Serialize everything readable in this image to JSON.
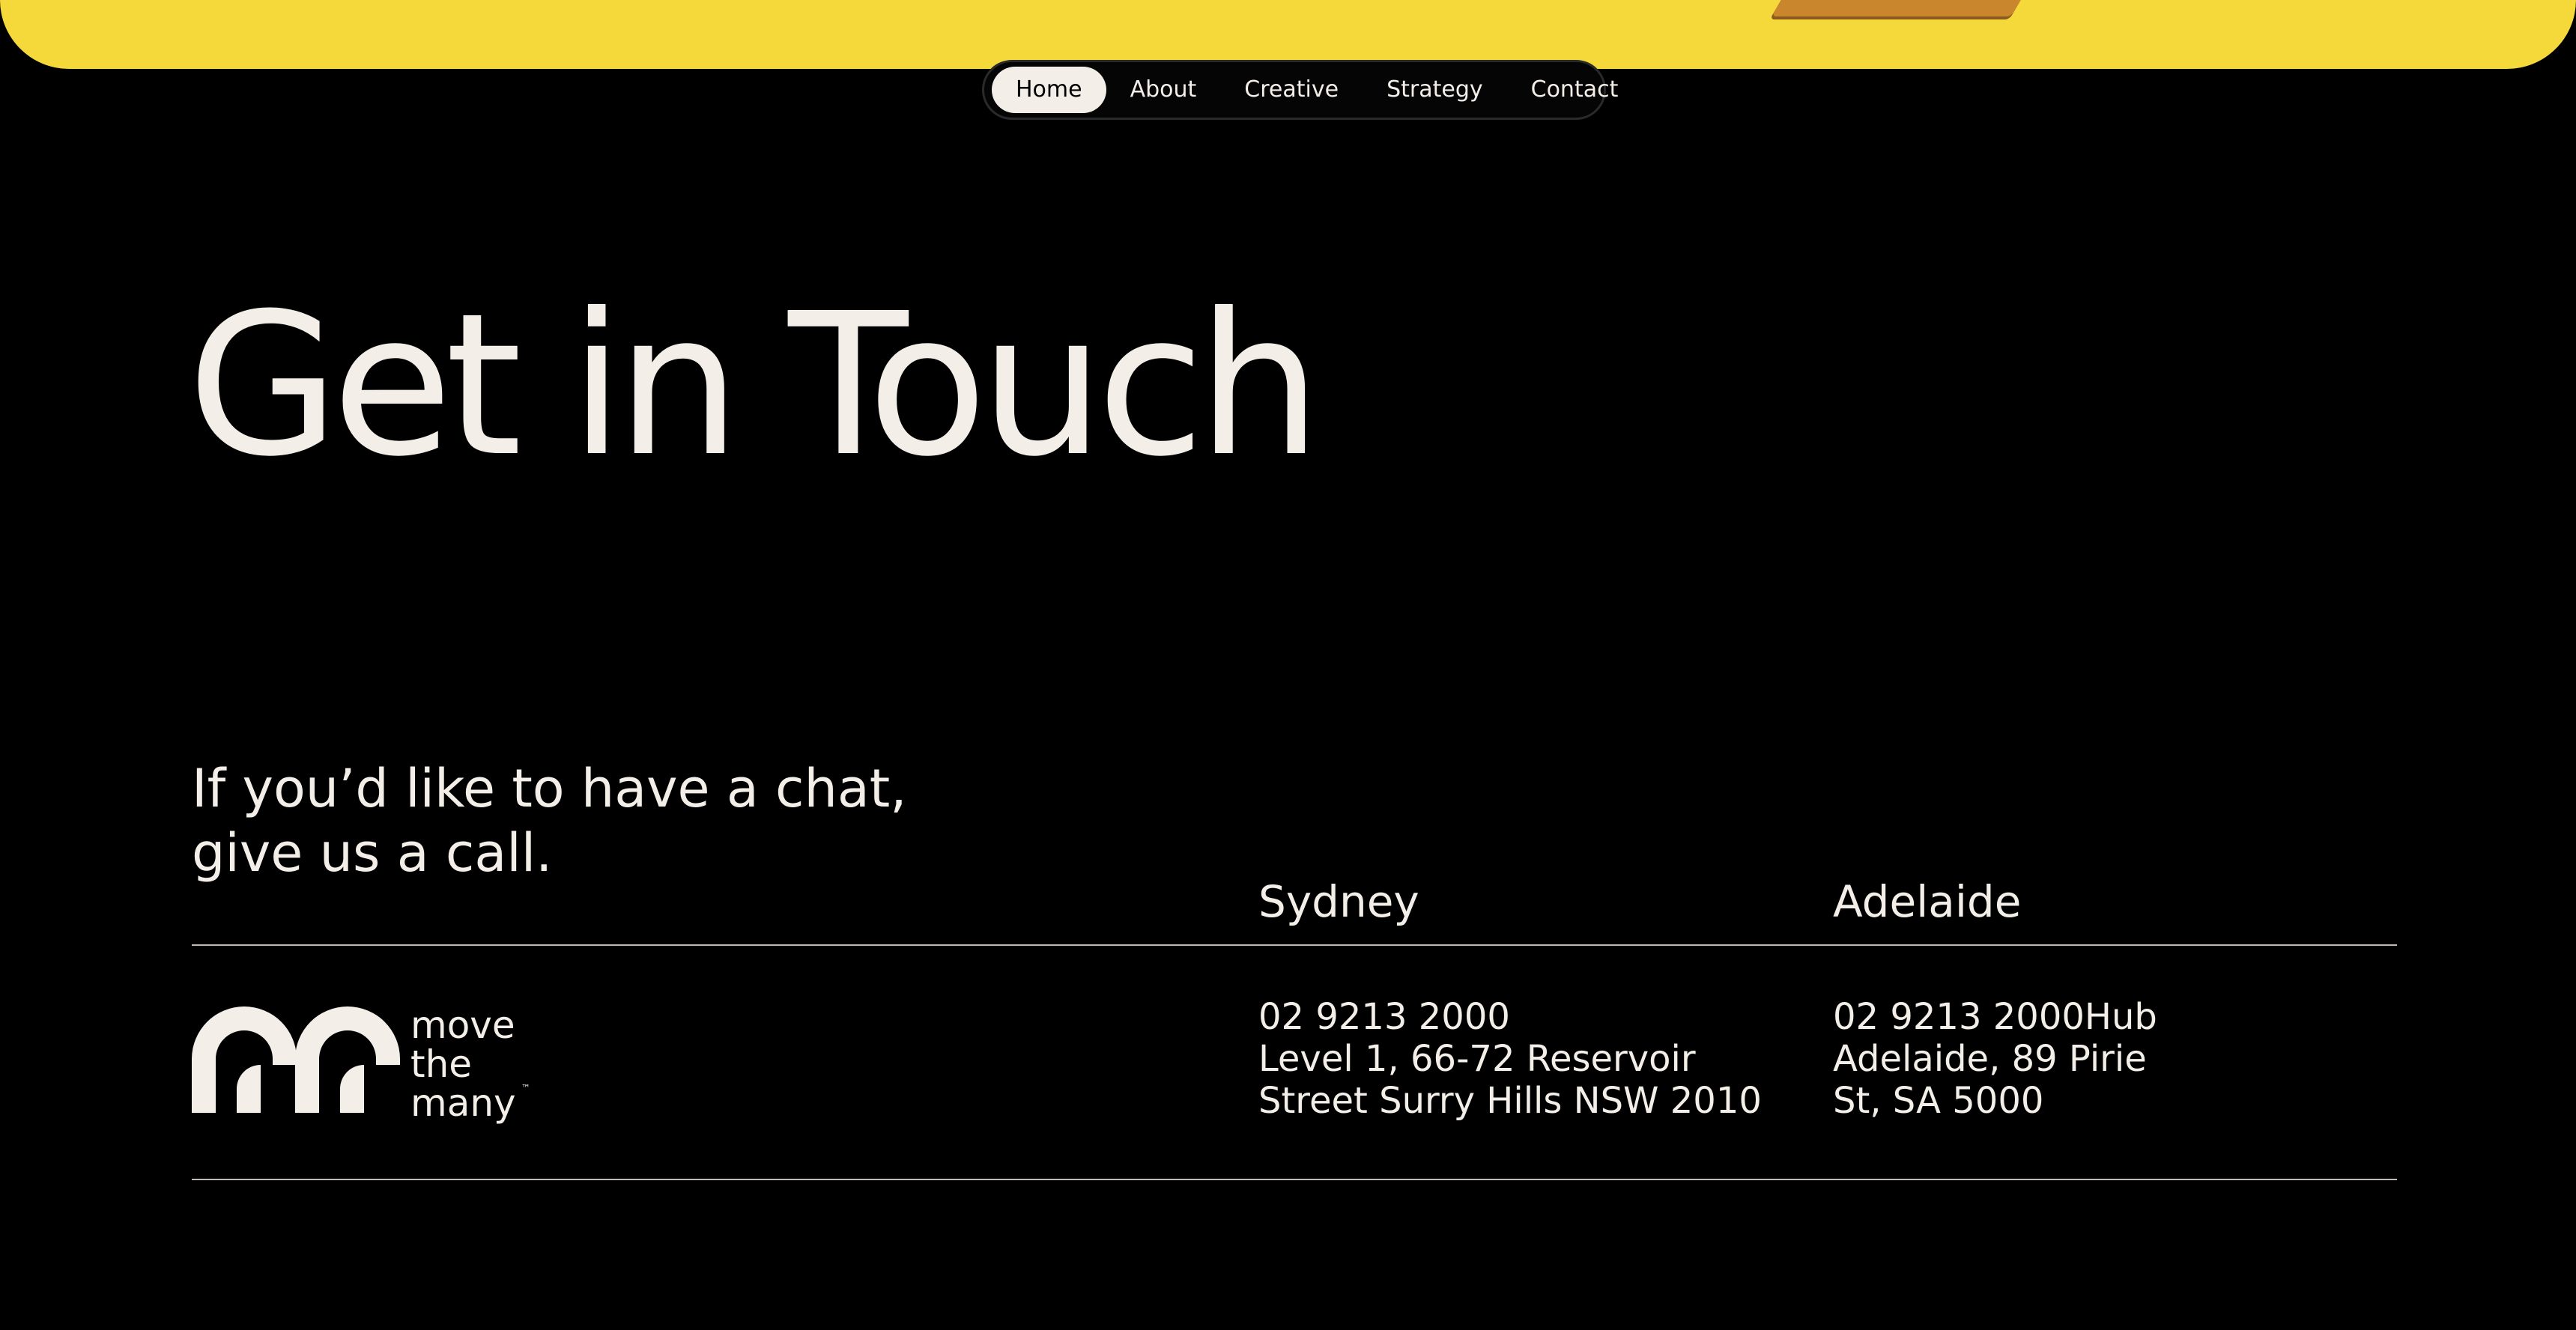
{
  "colors": {
    "banner": "#f5d93a",
    "background": "#000000",
    "text": "#f4eee8"
  },
  "nav": {
    "items": [
      {
        "label": "Home",
        "active": true
      },
      {
        "label": "About"
      },
      {
        "label": "Creative"
      },
      {
        "label": "Strategy"
      },
      {
        "label": "Contact"
      }
    ]
  },
  "main": {
    "title": "Get in Touch",
    "intro_line1": "If you’d like to have a chat,",
    "intro_line2": "give us a call."
  },
  "logo": {
    "icon": "mtm-monogram-icon",
    "line1": "move",
    "line2": "the",
    "line3": "many",
    "tm": "™"
  },
  "offices": {
    "sydney": {
      "name": "Sydney",
      "phone": "02 9213 2000",
      "address_line1": "Level 1, 66-72 Reservoir",
      "address_line2": "Street Surry Hills NSW 2010"
    },
    "adelaide": {
      "name": "Adelaide",
      "line1": "02 9213 2000Hub",
      "line2": "Adelaide, 89 Pirie",
      "line3": "St, SA 5000"
    }
  }
}
